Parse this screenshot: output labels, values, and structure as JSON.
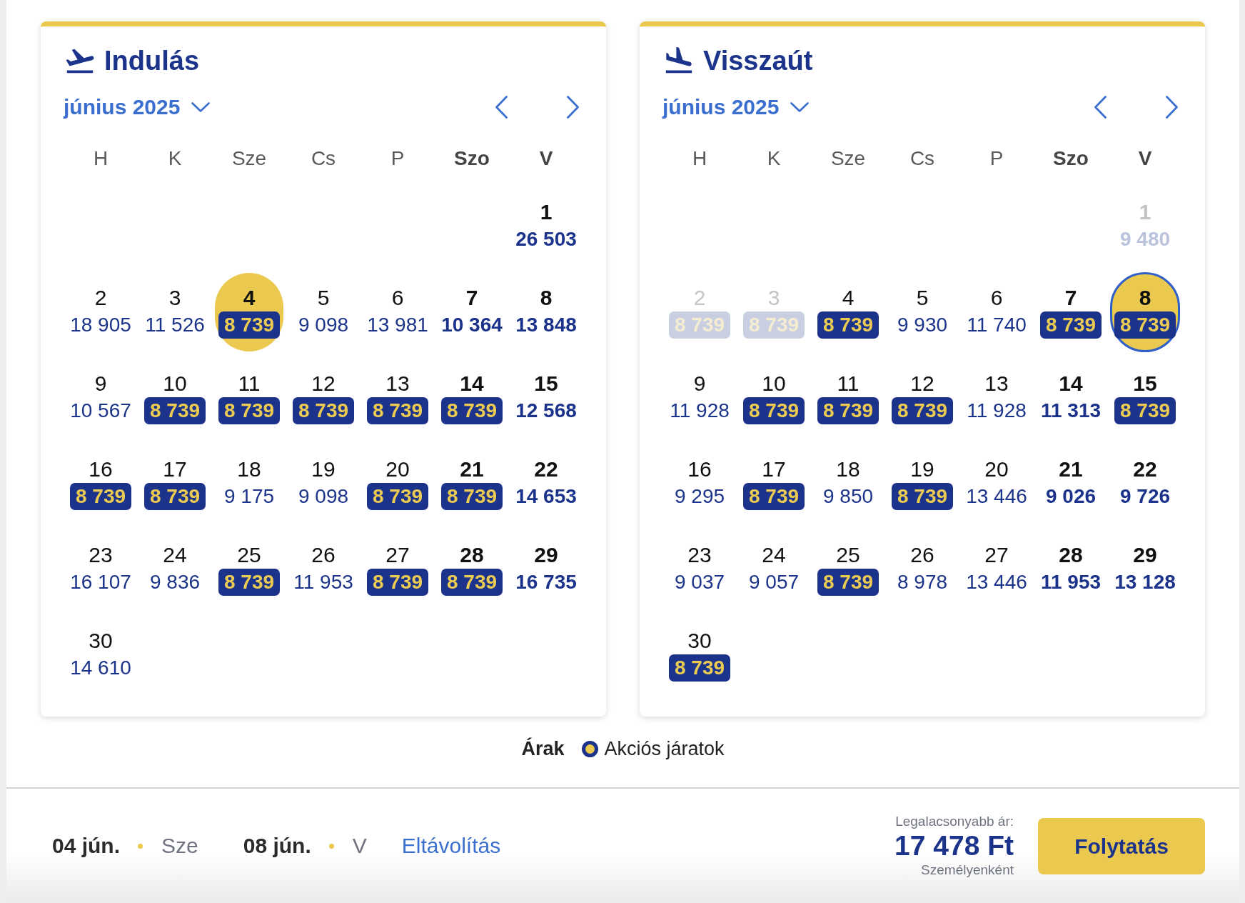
{
  "calendars": [
    {
      "kind": "departure",
      "title": "Indulás",
      "month": "június 2025",
      "weekdays": [
        {
          "label": "H",
          "weekend": false
        },
        {
          "label": "K",
          "weekend": false
        },
        {
          "label": "Sze",
          "weekend": false
        },
        {
          "label": "Cs",
          "weekend": false
        },
        {
          "label": "P",
          "weekend": false
        },
        {
          "label": "Szo",
          "weekend": true
        },
        {
          "label": "V",
          "weekend": true
        }
      ],
      "weeks": [
        {
          "days": [
            {
              "day": "1",
              "price": "26 503",
              "promo": false,
              "selected": false,
              "focused": false,
              "disabled": false
            }
          ]
        },
        {
          "days": [
            {
              "day": "2",
              "price": "18 905",
              "promo": false,
              "selected": false,
              "focused": false,
              "disabled": false
            },
            {
              "day": "3",
              "price": "11 526",
              "promo": false,
              "selected": false,
              "focused": false,
              "disabled": false
            },
            {
              "day": "4",
              "price": "8 739",
              "promo": true,
              "selected": true,
              "focused": false,
              "disabled": false
            },
            {
              "day": "5",
              "price": "9 098",
              "promo": false,
              "selected": false,
              "focused": false,
              "disabled": false
            },
            {
              "day": "6",
              "price": "13 981",
              "promo": false,
              "selected": false,
              "focused": false,
              "disabled": false
            },
            {
              "day": "7",
              "price": "10 364",
              "promo": false,
              "selected": false,
              "focused": false,
              "disabled": false
            },
            {
              "day": "8",
              "price": "13 848",
              "promo": false,
              "selected": false,
              "focused": false,
              "disabled": false
            }
          ]
        },
        {
          "days": [
            {
              "day": "9",
              "price": "10 567",
              "promo": false,
              "selected": false,
              "focused": false,
              "disabled": false
            },
            {
              "day": "10",
              "price": "8 739",
              "promo": true,
              "selected": false,
              "focused": false,
              "disabled": false
            },
            {
              "day": "11",
              "price": "8 739",
              "promo": true,
              "selected": false,
              "focused": false,
              "disabled": false
            },
            {
              "day": "12",
              "price": "8 739",
              "promo": true,
              "selected": false,
              "focused": false,
              "disabled": false
            },
            {
              "day": "13",
              "price": "8 739",
              "promo": true,
              "selected": false,
              "focused": false,
              "disabled": false
            },
            {
              "day": "14",
              "price": "8 739",
              "promo": true,
              "selected": false,
              "focused": false,
              "disabled": false
            },
            {
              "day": "15",
              "price": "12 568",
              "promo": false,
              "selected": false,
              "focused": false,
              "disabled": false
            }
          ]
        },
        {
          "days": [
            {
              "day": "16",
              "price": "8 739",
              "promo": true,
              "selected": false,
              "focused": false,
              "disabled": false
            },
            {
              "day": "17",
              "price": "8 739",
              "promo": true,
              "selected": false,
              "focused": false,
              "disabled": false
            },
            {
              "day": "18",
              "price": "9 175",
              "promo": false,
              "selected": false,
              "focused": false,
              "disabled": false
            },
            {
              "day": "19",
              "price": "9 098",
              "promo": false,
              "selected": false,
              "focused": false,
              "disabled": false
            },
            {
              "day": "20",
              "price": "8 739",
              "promo": true,
              "selected": false,
              "focused": false,
              "disabled": false
            },
            {
              "day": "21",
              "price": "8 739",
              "promo": true,
              "selected": false,
              "focused": false,
              "disabled": false
            },
            {
              "day": "22",
              "price": "14 653",
              "promo": false,
              "selected": false,
              "focused": false,
              "disabled": false
            }
          ]
        },
        {
          "days": [
            {
              "day": "23",
              "price": "16 107",
              "promo": false,
              "selected": false,
              "focused": false,
              "disabled": false
            },
            {
              "day": "24",
              "price": "9 836",
              "promo": false,
              "selected": false,
              "focused": false,
              "disabled": false
            },
            {
              "day": "25",
              "price": "8 739",
              "promo": true,
              "selected": false,
              "focused": false,
              "disabled": false
            },
            {
              "day": "26",
              "price": "11 953",
              "promo": false,
              "selected": false,
              "focused": false,
              "disabled": false
            },
            {
              "day": "27",
              "price": "8 739",
              "promo": true,
              "selected": false,
              "focused": false,
              "disabled": false
            },
            {
              "day": "28",
              "price": "8 739",
              "promo": true,
              "selected": false,
              "focused": false,
              "disabled": false
            },
            {
              "day": "29",
              "price": "16 735",
              "promo": false,
              "selected": false,
              "focused": false,
              "disabled": false
            }
          ]
        },
        {
          "days": [
            {
              "day": "30",
              "price": "14 610",
              "promo": false,
              "selected": false,
              "focused": false,
              "disabled": false
            }
          ]
        }
      ]
    },
    {
      "kind": "return",
      "title": "Visszaút",
      "month": "június 2025",
      "weekdays": [
        {
          "label": "H",
          "weekend": false
        },
        {
          "label": "K",
          "weekend": false
        },
        {
          "label": "Sze",
          "weekend": false
        },
        {
          "label": "Cs",
          "weekend": false
        },
        {
          "label": "P",
          "weekend": false
        },
        {
          "label": "Szo",
          "weekend": true
        },
        {
          "label": "V",
          "weekend": true
        }
      ],
      "weeks": [
        {
          "days": [
            {
              "day": "1",
              "price": "9 480",
              "promo": false,
              "selected": false,
              "focused": false,
              "disabled": true
            }
          ]
        },
        {
          "days": [
            {
              "day": "2",
              "price": "8 739",
              "promo": true,
              "selected": false,
              "focused": false,
              "disabled": true
            },
            {
              "day": "3",
              "price": "8 739",
              "promo": true,
              "selected": false,
              "focused": false,
              "disabled": true
            },
            {
              "day": "4",
              "price": "8 739",
              "promo": true,
              "selected": false,
              "focused": false,
              "disabled": false
            },
            {
              "day": "5",
              "price": "9 930",
              "promo": false,
              "selected": false,
              "focused": false,
              "disabled": false
            },
            {
              "day": "6",
              "price": "11 740",
              "promo": false,
              "selected": false,
              "focused": false,
              "disabled": false
            },
            {
              "day": "7",
              "price": "8 739",
              "promo": true,
              "selected": false,
              "focused": false,
              "disabled": false
            },
            {
              "day": "8",
              "price": "8 739",
              "promo": true,
              "selected": true,
              "focused": true,
              "disabled": false
            }
          ]
        },
        {
          "days": [
            {
              "day": "9",
              "price": "11 928",
              "promo": false,
              "selected": false,
              "focused": false,
              "disabled": false
            },
            {
              "day": "10",
              "price": "8 739",
              "promo": true,
              "selected": false,
              "focused": false,
              "disabled": false
            },
            {
              "day": "11",
              "price": "8 739",
              "promo": true,
              "selected": false,
              "focused": false,
              "disabled": false
            },
            {
              "day": "12",
              "price": "8 739",
              "promo": true,
              "selected": false,
              "focused": false,
              "disabled": false
            },
            {
              "day": "13",
              "price": "11 928",
              "promo": false,
              "selected": false,
              "focused": false,
              "disabled": false
            },
            {
              "day": "14",
              "price": "11 313",
              "promo": false,
              "selected": false,
              "focused": false,
              "disabled": false
            },
            {
              "day": "15",
              "price": "8 739",
              "promo": true,
              "selected": false,
              "focused": false,
              "disabled": false
            }
          ]
        },
        {
          "days": [
            {
              "day": "16",
              "price": "9 295",
              "promo": false,
              "selected": false,
              "focused": false,
              "disabled": false
            },
            {
              "day": "17",
              "price": "8 739",
              "promo": true,
              "selected": false,
              "focused": false,
              "disabled": false
            },
            {
              "day": "18",
              "price": "9 850",
              "promo": false,
              "selected": false,
              "focused": false,
              "disabled": false
            },
            {
              "day": "19",
              "price": "8 739",
              "promo": true,
              "selected": false,
              "focused": false,
              "disabled": false
            },
            {
              "day": "20",
              "price": "13 446",
              "promo": false,
              "selected": false,
              "focused": false,
              "disabled": false
            },
            {
              "day": "21",
              "price": "9 026",
              "promo": false,
              "selected": false,
              "focused": false,
              "disabled": false
            },
            {
              "day": "22",
              "price": "9 726",
              "promo": false,
              "selected": false,
              "focused": false,
              "disabled": false
            }
          ]
        },
        {
          "days": [
            {
              "day": "23",
              "price": "9 037",
              "promo": false,
              "selected": false,
              "focused": false,
              "disabled": false
            },
            {
              "day": "24",
              "price": "9 057",
              "promo": false,
              "selected": false,
              "focused": false,
              "disabled": false
            },
            {
              "day": "25",
              "price": "8 739",
              "promo": true,
              "selected": false,
              "focused": false,
              "disabled": false
            },
            {
              "day": "26",
              "price": "8 978",
              "promo": false,
              "selected": false,
              "focused": false,
              "disabled": false
            },
            {
              "day": "27",
              "price": "13 446",
              "promo": false,
              "selected": false,
              "focused": false,
              "disabled": false
            },
            {
              "day": "28",
              "price": "11 953",
              "promo": false,
              "selected": false,
              "focused": false,
              "disabled": false
            },
            {
              "day": "29",
              "price": "13 128",
              "promo": false,
              "selected": false,
              "focused": false,
              "disabled": false
            }
          ]
        },
        {
          "days": [
            {
              "day": "30",
              "price": "8 739",
              "promo": true,
              "selected": false,
              "focused": false,
              "disabled": false
            }
          ]
        }
      ]
    }
  ],
  "legend": {
    "title": "Árak",
    "label": "Akciós járatok"
  },
  "summary": {
    "trips": [
      {
        "date": "04 jún.",
        "weekday": "Sze"
      },
      {
        "date": "08 jún.",
        "weekday": "V"
      }
    ],
    "remove_link": "Eltávolítás",
    "price_caption": "Legalacsonyabb ár:",
    "price": "17 478 Ft",
    "price_note": "Személyenként",
    "continue_button": "Folytatás"
  }
}
